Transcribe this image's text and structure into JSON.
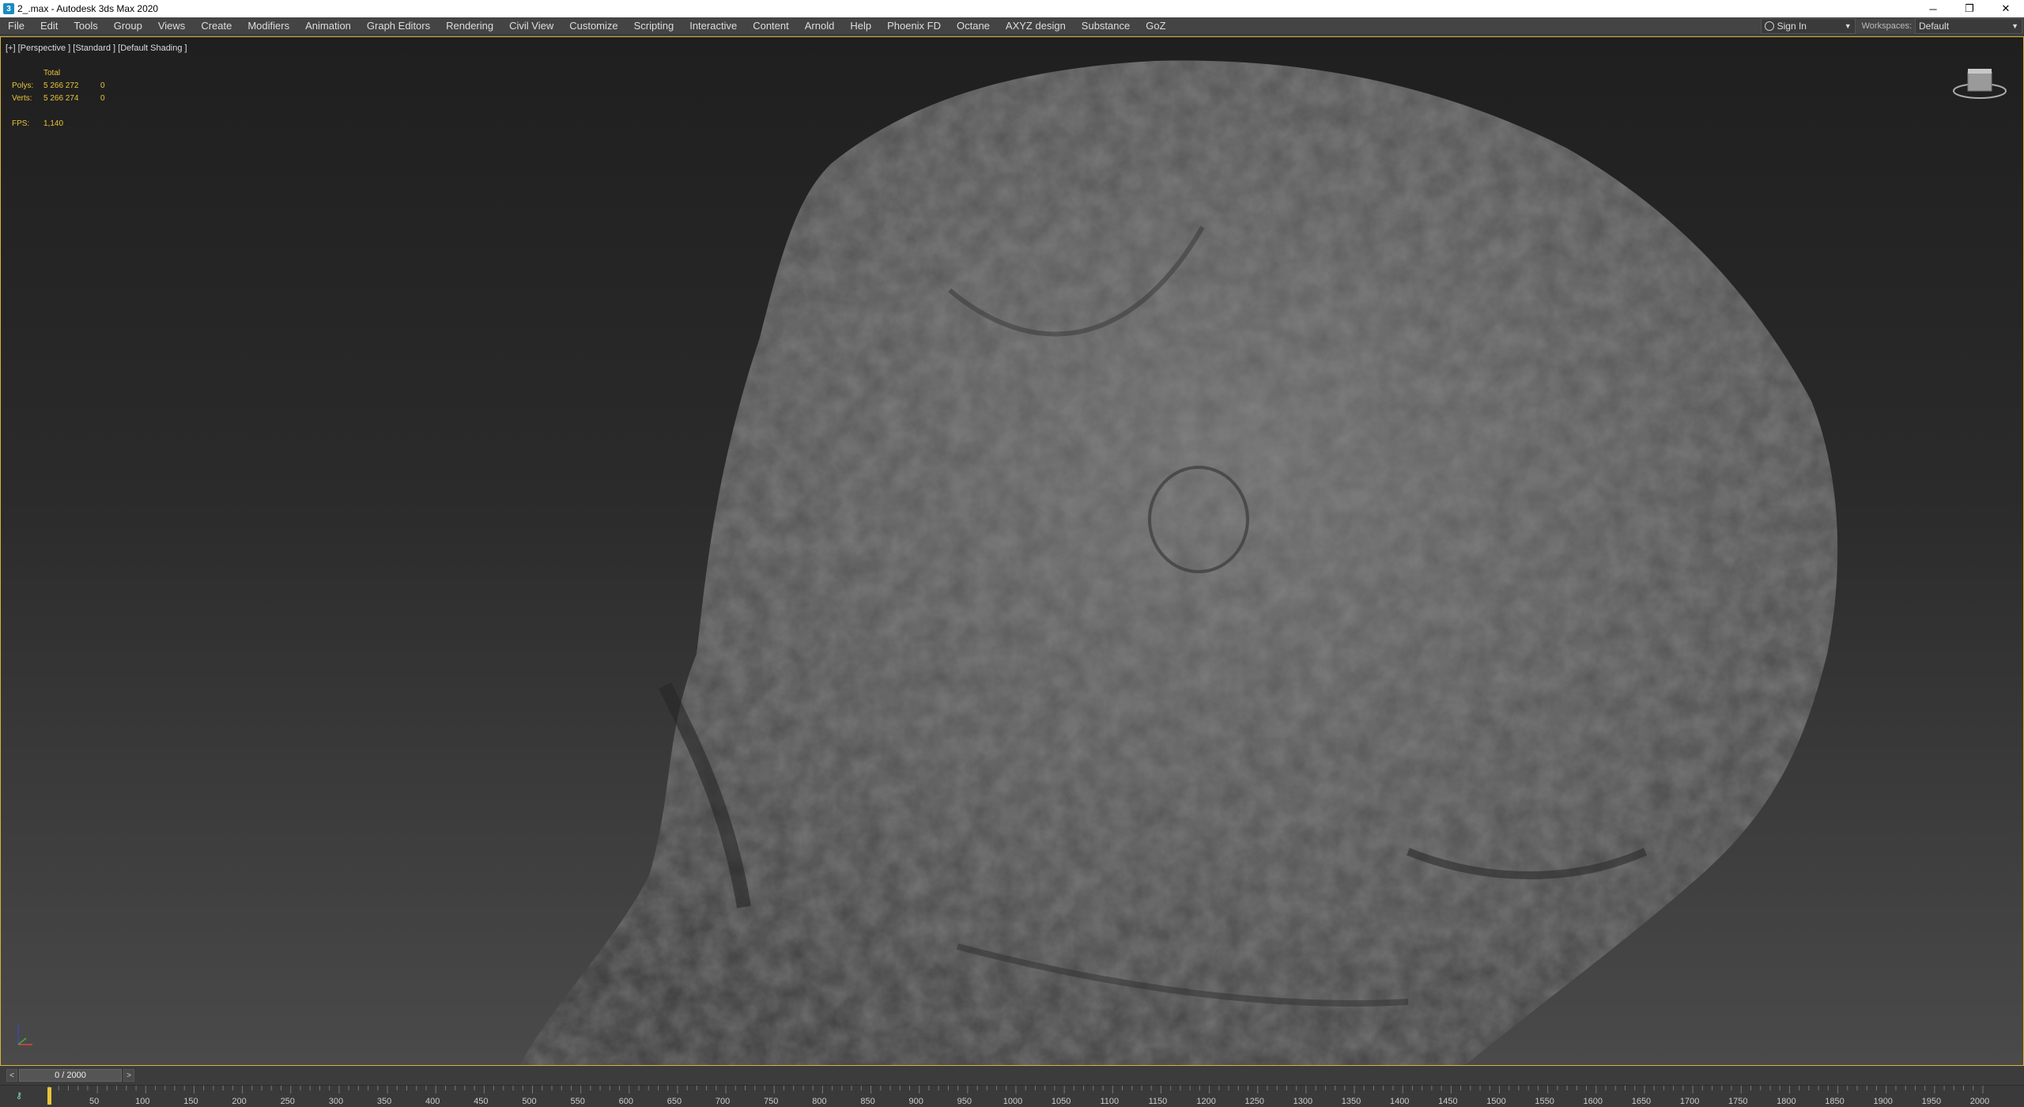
{
  "window": {
    "title": "2_.max - Autodesk 3ds Max 2020",
    "minimize": "─",
    "restore": "❐",
    "close": "✕"
  },
  "menu": [
    {
      "label": "File"
    },
    {
      "label": "Edit"
    },
    {
      "label": "Tools"
    },
    {
      "label": "Group"
    },
    {
      "label": "Views"
    },
    {
      "label": "Create"
    },
    {
      "label": "Modifiers"
    },
    {
      "label": "Animation"
    },
    {
      "label": "Graph Editors"
    },
    {
      "label": "Rendering"
    },
    {
      "label": "Civil View"
    },
    {
      "label": "Customize"
    },
    {
      "label": "Scripting"
    },
    {
      "label": "Interactive"
    },
    {
      "label": "Content"
    },
    {
      "label": "Arnold"
    },
    {
      "label": "Help"
    },
    {
      "label": "Phoenix FD"
    },
    {
      "label": "Octane"
    },
    {
      "label": "AXYZ design"
    },
    {
      "label": "Substance"
    },
    {
      "label": "GoZ"
    }
  ],
  "account": {
    "signin_label": "Sign In"
  },
  "workspace": {
    "label": "Workspaces:",
    "value": "Default"
  },
  "viewport": {
    "label": "[+] [Perspective ] [Standard ] [Default Shading ]",
    "stats": {
      "header": "Total",
      "polys_label": "Polys:",
      "polys_total": "5 266 272",
      "polys_sel": "0",
      "verts_label": "Verts:",
      "verts_total": "5 266 274",
      "verts_sel": "0",
      "fps_label": "FPS:",
      "fps_value": "1,140"
    }
  },
  "timeline": {
    "prev": "<",
    "next": ">",
    "frame_display": "0 / 2000",
    "ruler_labels": [
      "50",
      "100",
      "150",
      "200",
      "250",
      "300",
      "350",
      "400",
      "450",
      "500",
      "550",
      "600",
      "650",
      "700",
      "750",
      "800",
      "850",
      "900",
      "950",
      "1000",
      "1050",
      "1100",
      "1150",
      "1200",
      "1250",
      "1300",
      "1350",
      "1400",
      "1450",
      "1500",
      "1550",
      "1600",
      "1650",
      "1700",
      "1750",
      "1800",
      "1850",
      "1900",
      "1950",
      "2000"
    ]
  },
  "colors": {
    "accent": "#e8c43a",
    "viewport_border": "#d8b23a",
    "rock": "#5a5a5a"
  }
}
